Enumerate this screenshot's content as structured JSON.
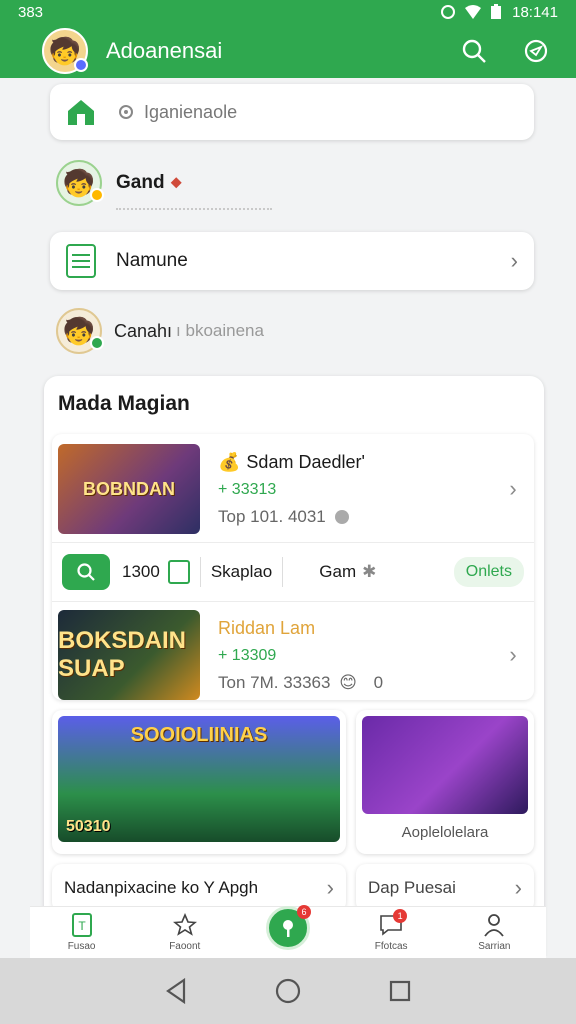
{
  "status_bar": {
    "time_left": "383",
    "time_right": "18:141"
  },
  "app_bar": {
    "title": "Adoanensai"
  },
  "search": {
    "placeholder": "Iganienaole"
  },
  "profile_row": {
    "name": "Gand",
    "flag": "⬥"
  },
  "menu_row": {
    "label": "Namune"
  },
  "secondary_row": {
    "label_bold": "Canahı",
    "label_light": "ı bkoainena"
  },
  "section": {
    "title": "Mada Magian",
    "games": [
      {
        "thumb_text": "BOBNDAN",
        "name": "Sdam Daedler'",
        "score": "+ 33313",
        "meta": "Top 101. 4031"
      },
      {
        "thumb_text": "BOKSDAIN SUAP",
        "name": "Riddan Lam",
        "score": "+ 13309",
        "meta": "Ton 7M. 33363",
        "meta_extra": "0"
      }
    ],
    "filter": {
      "count": "1300",
      "text": "Skaplao",
      "game": "Gam",
      "pill": "Onlets"
    },
    "promo_big": {
      "title": "SOOIOLIINIAS",
      "foot": "50310"
    },
    "promo_small": {
      "caption": "Aoplelolelara"
    }
  },
  "links": {
    "left": "Nadanpixacine ko Y Apgh",
    "right": "Dap Puesai"
  },
  "bottom_nav": [
    {
      "label": "Fusao"
    },
    {
      "label": "Faoont"
    },
    {
      "label": "",
      "badge": "6"
    },
    {
      "label": "Ffotcas",
      "badge": "1"
    },
    {
      "label": "Sarrian"
    }
  ],
  "colors": {
    "brand_green": "#2fa84f",
    "accent_orange": "#e0a43a",
    "badge_red": "#e53935"
  }
}
